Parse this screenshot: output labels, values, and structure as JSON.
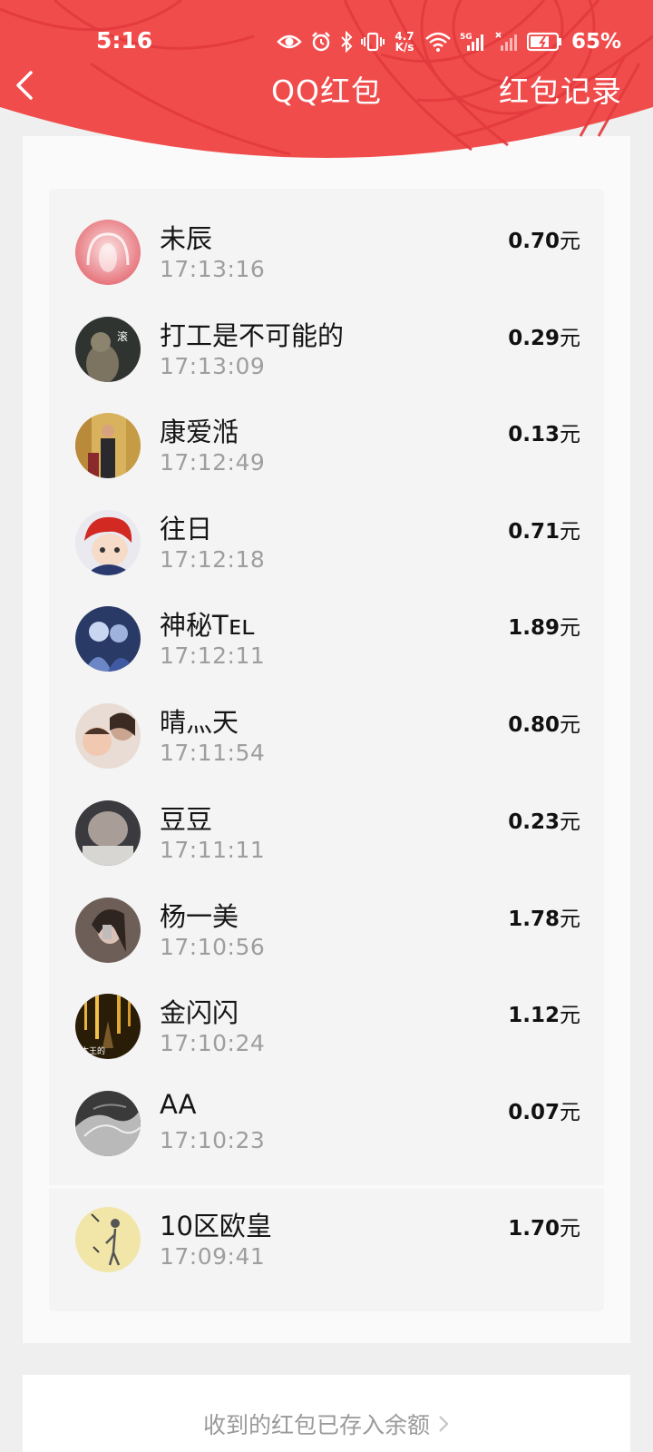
{
  "status_bar": {
    "time": "5:16",
    "net_speed_top": "4.7",
    "net_speed_bottom": "K/s",
    "signal_label": "5G",
    "battery": "65%"
  },
  "nav": {
    "title": "QQ红包",
    "right_link": "红包记录"
  },
  "records": [
    {
      "name": "未辰",
      "time": "17:13:16",
      "amount": "0.70",
      "unit": "元"
    },
    {
      "name": "打工是不可能的",
      "time": "17:13:09",
      "amount": "0.29",
      "unit": "元"
    },
    {
      "name": "康爱湉",
      "time": "17:12:49",
      "amount": "0.13",
      "unit": "元"
    },
    {
      "name": "往日",
      "time": "17:12:18",
      "amount": "0.71",
      "unit": "元"
    },
    {
      "name": "神秘Tᴇʟ",
      "time": "17:12:11",
      "amount": "1.89",
      "unit": "元"
    },
    {
      "name": "晴灬天",
      "time": "17:11:54",
      "amount": "0.80",
      "unit": "元"
    },
    {
      "name": "豆豆",
      "time": "17:11:11",
      "amount": "0.23",
      "unit": "元"
    },
    {
      "name": "杨一美",
      "time": "17:10:56",
      "amount": "1.78",
      "unit": "元"
    },
    {
      "name": "金闪闪",
      "time": "17:10:24",
      "amount": "1.12",
      "unit": "元"
    },
    {
      "name": "AA",
      "time": "17:10:23",
      "amount": "0.07",
      "unit": "元"
    },
    {
      "name": "10区欧皇",
      "time": "17:09:41",
      "amount": "1.70",
      "unit": "元"
    }
  ],
  "avatar_text": {
    "r1": "滚",
    "r8": "本王的"
  },
  "footer": {
    "text": "收到的红包已存入余额"
  },
  "colors": {
    "header_red": "#f14c4c",
    "header_pattern": "#e23a3d"
  }
}
